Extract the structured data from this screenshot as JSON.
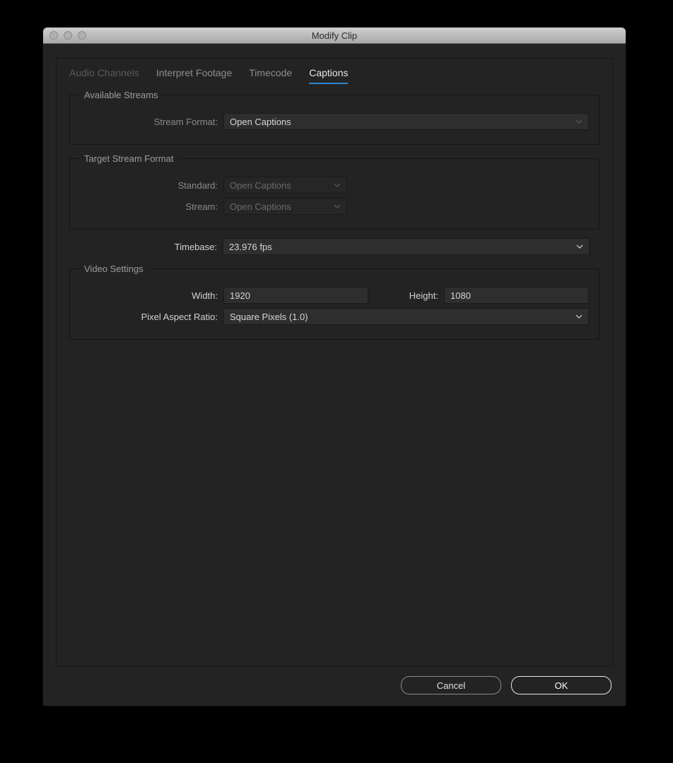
{
  "window": {
    "title": "Modify Clip"
  },
  "tabs": {
    "audio_channels": "Audio Channels",
    "interpret_footage": "Interpret Footage",
    "timecode": "Timecode",
    "captions": "Captions"
  },
  "available_streams": {
    "legend": "Available Streams",
    "stream_format_label": "Stream Format:",
    "stream_format_value": "Open Captions"
  },
  "target_stream_format": {
    "legend": "Target Stream Format",
    "standard_label": "Standard:",
    "standard_value": "Open Captions",
    "stream_label": "Stream:",
    "stream_value": "Open Captions"
  },
  "timebase": {
    "label": "Timebase:",
    "value": "23.976 fps"
  },
  "video_settings": {
    "legend": "Video Settings",
    "width_label": "Width:",
    "width_value": "1920",
    "height_label": "Height:",
    "height_value": "1080",
    "par_label": "Pixel Aspect Ratio:",
    "par_value": "Square Pixels (1.0)"
  },
  "buttons": {
    "cancel": "Cancel",
    "ok": "OK"
  }
}
